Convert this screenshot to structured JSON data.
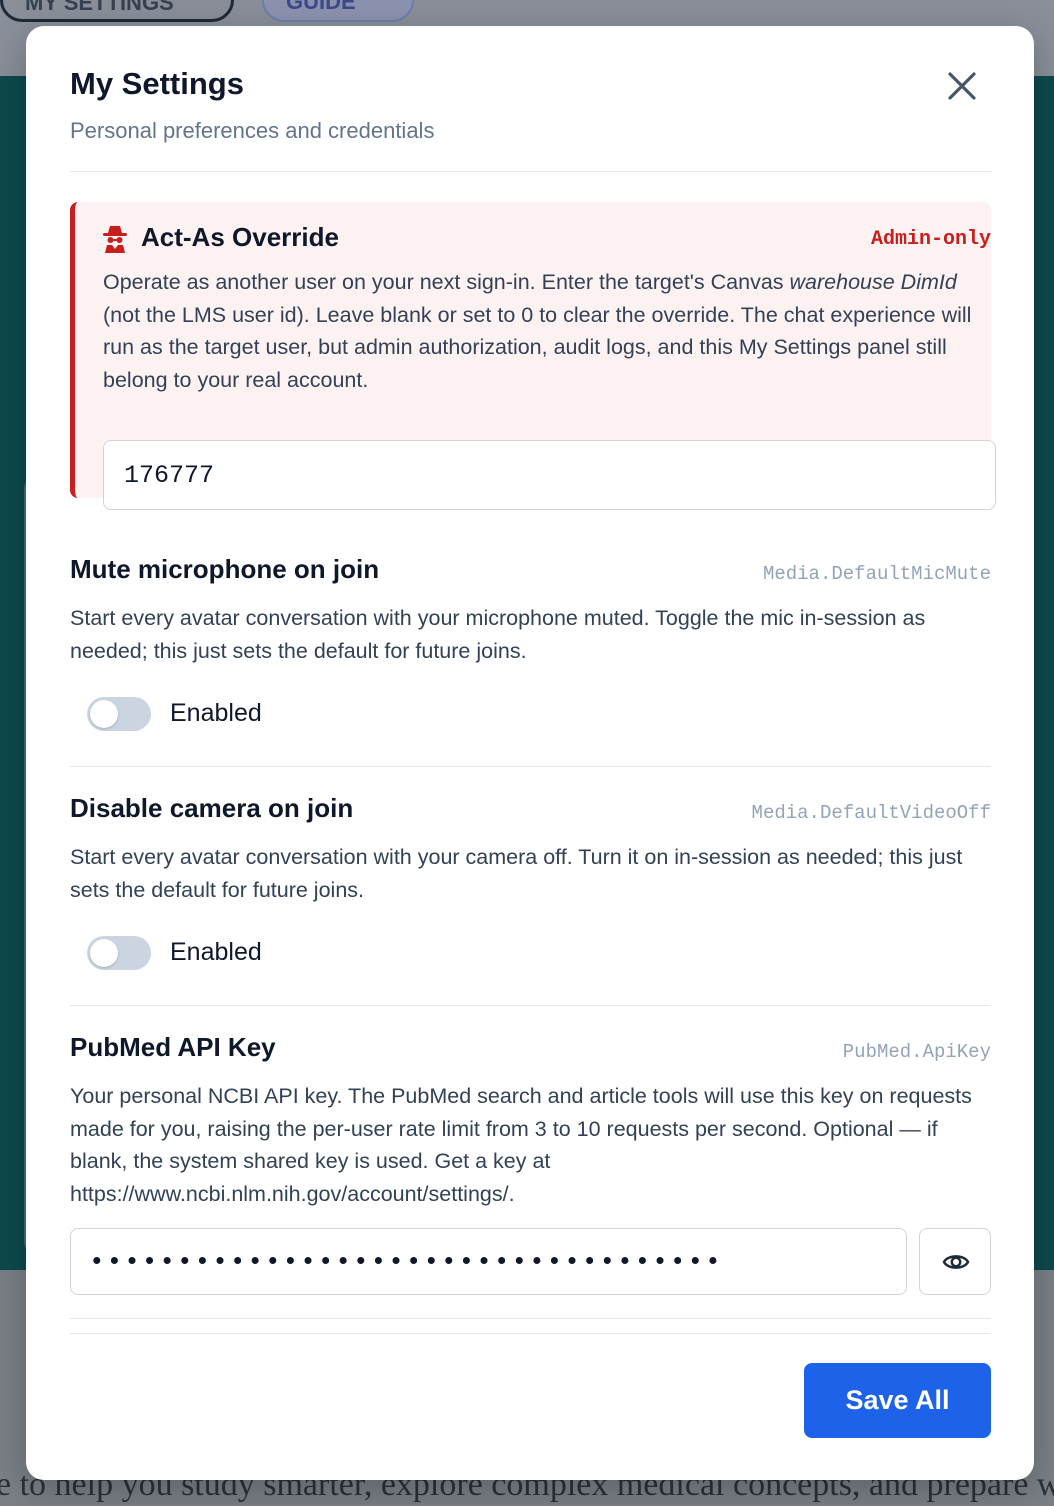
{
  "background": {
    "my_settings_pill": "MY SETTINGS",
    "guide_pill": "GUIDE",
    "bottom_text": "e to help you study smarter, explore complex medical concepts, and prepare with"
  },
  "modal": {
    "title": "My Settings",
    "subtitle": "Personal preferences and credentials",
    "close_icon": "close-icon"
  },
  "act_as": {
    "icon": "spy-icon",
    "title": "Act-As Override",
    "badge": "Admin-only",
    "desc_1": "Operate as another user on your next sign-in. Enter the target's Canvas ",
    "desc_em": "warehouse DimId",
    "desc_2": " (not the LMS user id). Leave blank or set to 0 to clear the override. The chat experience will run as the target user, but admin authorization, audit logs, and this My Settings panel still belong to your real account.",
    "value": "176777"
  },
  "settings": [
    {
      "title": "Mute microphone on join",
      "key": "Media.DefaultMicMute",
      "description": "Start every avatar conversation with your microphone muted. Toggle the mic in-session as needed; this just sets the default for future joins.",
      "toggle_label": "Enabled",
      "enabled": false
    },
    {
      "title": "Disable camera on join",
      "key": "Media.DefaultVideoOff",
      "description": "Start every avatar conversation with your camera off. Turn it on in-session as needed; this just sets the default for future joins.",
      "toggle_label": "Enabled",
      "enabled": false
    }
  ],
  "pubmed": {
    "title": "PubMed API Key",
    "key": "PubMed.ApiKey",
    "description": "Your personal NCBI API key. The PubMed search and article tools will use this key on requests made for you, raising the per-user rate limit from 3 to 10 requests per second. Optional — if blank, the system shared key is used. Get a key at https://www.ncbi.nlm.nih.gov/account/settings/.",
    "value": "••••••••••••••••••••••••••••••••••••",
    "reveal_icon": "eye-icon"
  },
  "footer": {
    "save_label": "Save All"
  },
  "colors": {
    "accent": "#1d63ea",
    "danger": "#c81e1e",
    "danger_bg": "#fdf2f2"
  }
}
